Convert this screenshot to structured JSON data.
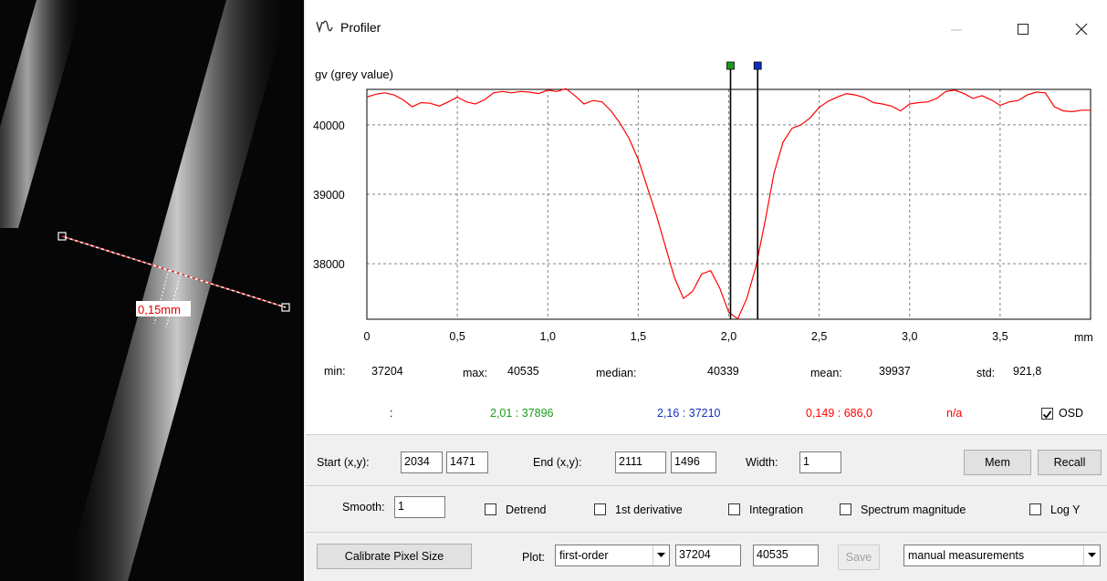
{
  "window": {
    "title": "Profiler"
  },
  "image_overlay": {
    "measurement_label": "0,15mm"
  },
  "chart_data": {
    "type": "line",
    "ylabel": "gv (grey value)",
    "xunit": "mm",
    "xlim": [
      0,
      4.0
    ],
    "ylim": [
      37200,
      40510
    ],
    "xticks": [
      0,
      0.5,
      1.0,
      1.5,
      2.0,
      2.5,
      3.0,
      3.5
    ],
    "xtick_labels": [
      "0",
      "0,5",
      "1,0",
      "1,5",
      "2,0",
      "2,5",
      "3,0",
      "3,5"
    ],
    "yticks": [
      38000,
      39000,
      40000
    ],
    "ytick_labels": [
      "38000",
      "39000",
      "40000"
    ],
    "grid": true,
    "markers": [
      {
        "x": 2.01,
        "color": "#1a9a1a"
      },
      {
        "x": 2.16,
        "color": "#1030c0"
      }
    ],
    "series": [
      {
        "color": "#ff0000",
        "x": [
          0,
          0.05,
          0.1,
          0.15,
          0.2,
          0.25,
          0.3,
          0.35,
          0.4,
          0.45,
          0.5,
          0.55,
          0.6,
          0.65,
          0.7,
          0.75,
          0.8,
          0.85,
          0.9,
          0.95,
          1.0,
          1.05,
          1.1,
          1.15,
          1.2,
          1.25,
          1.3,
          1.35,
          1.4,
          1.45,
          1.5,
          1.55,
          1.6,
          1.65,
          1.7,
          1.75,
          1.8,
          1.85,
          1.9,
          1.95,
          2.0,
          2.05,
          2.1,
          2.15,
          2.2,
          2.25,
          2.3,
          2.35,
          2.4,
          2.45,
          2.5,
          2.55,
          2.6,
          2.65,
          2.7,
          2.75,
          2.8,
          2.85,
          2.9,
          2.95,
          3.0,
          3.05,
          3.1,
          3.15,
          3.2,
          3.25,
          3.3,
          3.35,
          3.4,
          3.45,
          3.5,
          3.55,
          3.6,
          3.65,
          3.7,
          3.75,
          3.8,
          3.85,
          3.9,
          3.95,
          4.0
        ],
        "y": [
          40400,
          40440,
          40460,
          40430,
          40360,
          40260,
          40320,
          40310,
          40270,
          40330,
          40400,
          40330,
          40300,
          40360,
          40460,
          40480,
          40460,
          40480,
          40470,
          40450,
          40500,
          40480,
          40520,
          40420,
          40300,
          40350,
          40330,
          40200,
          40020,
          39800,
          39500,
          39100,
          38700,
          38250,
          37800,
          37500,
          37600,
          37850,
          37900,
          37650,
          37300,
          37205,
          37500,
          37950,
          38600,
          39300,
          39750,
          39950,
          40000,
          40100,
          40250,
          40340,
          40400,
          40450,
          40430,
          40390,
          40320,
          40300,
          40270,
          40200,
          40300,
          40320,
          40330,
          40380,
          40480,
          40500,
          40450,
          40380,
          40420,
          40360,
          40280,
          40330,
          40350,
          40430,
          40470,
          40460,
          40260,
          40200,
          40190,
          40210,
          40210
        ]
      }
    ]
  },
  "stats": {
    "min_label": "min:",
    "min_value": "37204",
    "max_label": "max:",
    "max_value": "40535",
    "median_label": "median:",
    "median_value": "40339",
    "mean_label": "mean:",
    "mean_value": "39937",
    "std_label": "std:",
    "std_value": "921,8"
  },
  "markers_row": {
    "colon": ":",
    "green": "2,01  :  37896",
    "blue": "2,16  :  37210",
    "red": "0,149  :  686,0",
    "na": "n/a",
    "osd_label": "OSD",
    "osd_checked": true
  },
  "coords": {
    "start_label": "Start (x,y):",
    "start_x": "2034",
    "start_y": "1471",
    "end_label": "End (x,y):",
    "end_x": "2111",
    "end_y": "1496",
    "width_label": "Width:",
    "width_value": "1",
    "mem_label": "Mem",
    "recall_label": "Recall"
  },
  "options": {
    "smooth_label": "Smooth:",
    "smooth_value": "1",
    "detrend_label": "Detrend",
    "derivative_label": "1st derivative",
    "integration_label": "Integration",
    "spectrum_label": "Spectrum magnitude",
    "logy_label": "Log Y"
  },
  "bottom": {
    "calibrate_label": "Calibrate Pixel Size",
    "plot_label": "Plot:",
    "plot_value": "first-order",
    "range_min": "37204",
    "range_max": "40535",
    "save_label": "Save",
    "mode_value": "manual measurements"
  }
}
